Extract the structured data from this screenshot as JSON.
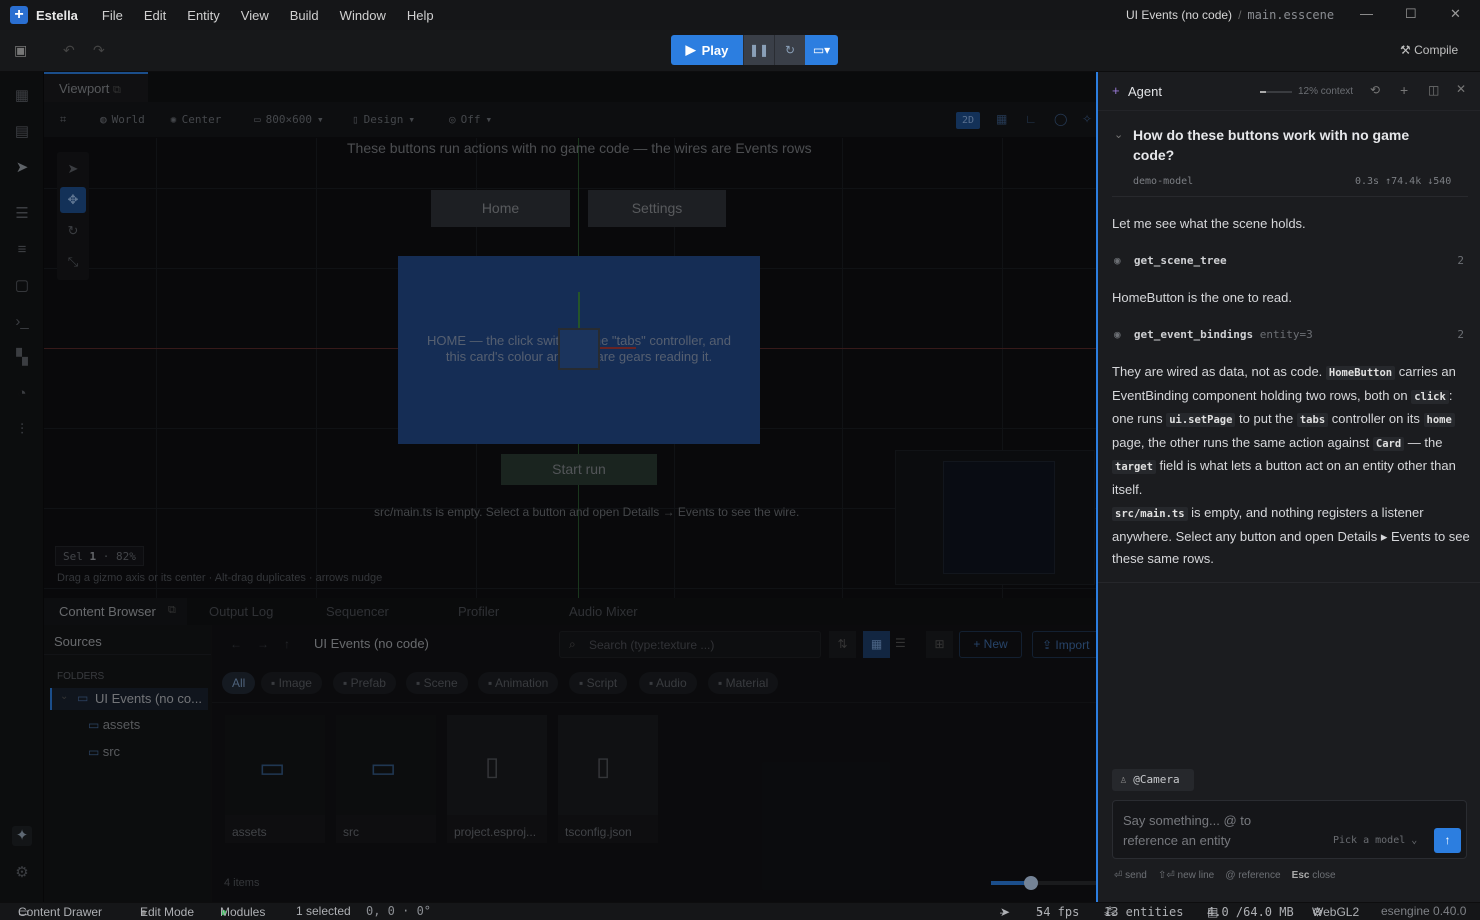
{
  "app": {
    "name": "Estella",
    "doc_title": "UI Events (no code)",
    "doc_file": "main.esscene"
  },
  "menu": [
    "File",
    "Edit",
    "Entity",
    "View",
    "Build",
    "Window",
    "Help"
  ],
  "toolbar": {
    "play_label": "Play",
    "compile_label": "Compile"
  },
  "viewport": {
    "tab_label": "Viewport",
    "space": "World",
    "pivot": "Center",
    "resolution": "800×600",
    "mode": "Design",
    "snap": "Off",
    "dim_badge": "2D",
    "scene": {
      "header": "These buttons run actions with no game code — the wires are Events rows",
      "home_button": "Home",
      "settings_button": "Settings",
      "card_line1": "HOME — the click switches the \"tabs\" controller, and",
      "card_line2": "this card's colour and text are gears reading it.",
      "start_button": "Start run",
      "footer": "src/main.ts is empty. Select a button and open Details → Events to see the wire."
    },
    "sel_label": "Sel",
    "sel_count": "1",
    "zoom": "82%",
    "hint": "Drag a gizmo axis or its center · Alt-drag duplicates · arrows nudge"
  },
  "bottom_tabs": [
    "Content Browser",
    "Output Log",
    "Sequencer",
    "Profiler",
    "Audio Mixer"
  ],
  "content_browser": {
    "sources_title": "Sources",
    "folders_label": "FOLDERS",
    "tree": [
      "UI Events (no co...",
      "assets",
      "src"
    ],
    "path": "UI Events (no code)",
    "search_placeholder": "Search (type:texture ...)",
    "new_label": "New",
    "import_label": "Import",
    "filters": [
      "All",
      "Image",
      "Prefab",
      "Scene",
      "Animation",
      "Script",
      "Audio",
      "Material"
    ],
    "items": [
      {
        "name": "assets",
        "type": "folder"
      },
      {
        "name": "src",
        "type": "folder"
      },
      {
        "name": "project.esproj...",
        "type": "file"
      },
      {
        "name": "tsconfig.json",
        "type": "file"
      }
    ],
    "count": "4 items"
  },
  "agent": {
    "title": "Agent",
    "context": "12% context",
    "question": "How do these buttons work with no game code?",
    "model": "demo-model",
    "stats": "0.3s ↑74.4k ↓540",
    "msg1": "Let me see what the scene holds.",
    "tool1": {
      "name": "get_scene_tree",
      "args": "",
      "count": "2"
    },
    "msg2": "HomeButton is the one to read.",
    "tool2": {
      "name": "get_event_bindings",
      "args": "entity=3",
      "count": "2"
    },
    "para1": [
      "They are wired as data, not as code. ",
      {
        "code": "HomeButton"
      },
      " carries an EventBinding component holding two rows, both on ",
      {
        "code": "click"
      },
      ": one runs ",
      {
        "code": "ui.setPage"
      },
      " to put the ",
      {
        "code": "tabs"
      },
      " controller on its ",
      {
        "code": "home"
      },
      " page, the other runs the same action against ",
      {
        "code": "Card"
      },
      " — the ",
      {
        "code": "target"
      },
      " field is what lets a button act on an entity other than itself."
    ],
    "para2": [
      {
        "code": "src/main.ts"
      },
      " is empty, and nothing registers a listener anywhere. Select any button and open Details ▸ Events to see these same rows."
    ],
    "mention": "@Camera",
    "input_placeholder": "Say something... @ to reference an entity",
    "model_picker": "Pick a model",
    "hints": {
      "send": "send",
      "newline": "new line",
      "reference": "reference",
      "esc_key": "Esc",
      "esc_label": "close"
    }
  },
  "status": {
    "content_drawer": "Content Drawer",
    "edit_mode": "Edit Mode",
    "modules": "Modules",
    "selected": "1 selected",
    "coords": "0, 0 · 0°",
    "pointer": "–",
    "fps": "54 fps",
    "entities": "13 entities",
    "memory": "4.0 /64.0 MB",
    "renderer": "WebGL2",
    "version": "esengine 0.40.0"
  },
  "colors": {
    "accent": "#2c7ee0",
    "card": "#23498a",
    "modules_dot": "#3fbf5f"
  }
}
